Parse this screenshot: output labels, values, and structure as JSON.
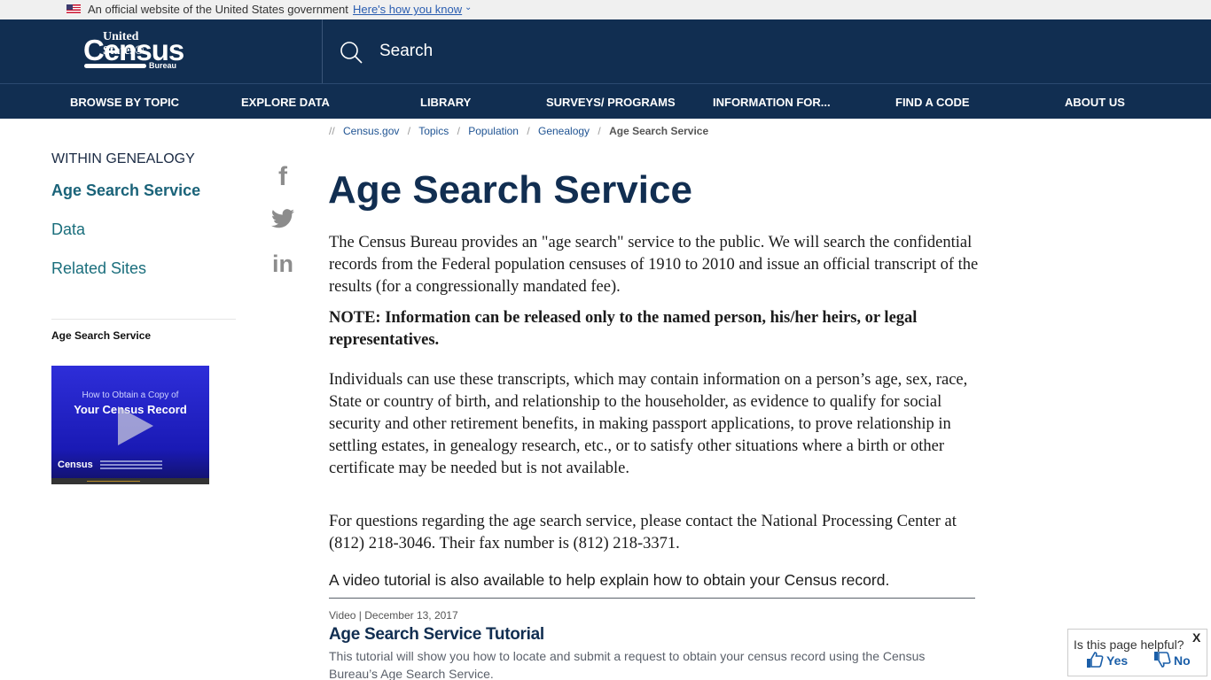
{
  "gov_banner": {
    "text": "An official website of the United States government",
    "link": "Here's how you know",
    "chevron": "⌄"
  },
  "header": {
    "logo": {
      "top": "United States®",
      "main": "Census",
      "bottom": "Bureau"
    },
    "search_label": "Search"
  },
  "nav": {
    "items": [
      {
        "label": "BROWSE BY TOPIC"
      },
      {
        "label": "EXPLORE DATA"
      },
      {
        "label": "LIBRARY"
      },
      {
        "label": "SURVEYS/ PROGRAMS"
      },
      {
        "label": "INFORMATION FOR..."
      },
      {
        "label": "FIND A CODE"
      },
      {
        "label": "ABOUT US"
      }
    ]
  },
  "breadcrumb": {
    "lead": "//",
    "sep": "/",
    "items": [
      "Census.gov",
      "Topics",
      "Population",
      "Genealogy"
    ],
    "current": "Age Search Service"
  },
  "sidebar": {
    "heading": "WITHIN GENEALOGY",
    "links": [
      {
        "label": "Age Search Service",
        "active": true
      },
      {
        "label": "Data"
      },
      {
        "label": "Related Sites"
      }
    ],
    "video_caption": "Age Search Service",
    "video_thumb": {
      "line1": "How to Obtain a Copy of",
      "line2": "Your Census Record",
      "logo": "Census"
    }
  },
  "social": {
    "facebook": "f",
    "linkedin": "in"
  },
  "main": {
    "title": "Age Search Service",
    "paragraphs": [
      "The Census Bureau provides an \"age search\" service to the public. We will search the confidential records from the Federal population censuses of 1910 to 2010 and issue an official transcript of the results (for a congressionally mandated fee).",
      "NOTE: Information can be released only to the named person, his/her heirs, or legal representatives.",
      "Individuals can use these transcripts, which may contain information on a person’s age, sex, race, State or country of birth, and relationship to the householder, as evidence to qualify for social security and other retirement benefits, in making passport applications, to prove relationship in settling estates, in genealogy research, etc., or to satisfy other situations where a birth or other certificate may be needed but is not available.",
      "For questions regarding the age search service, please contact the National Processing Center at (812) 218-3046. Their fax number is (812) 218-3371."
    ],
    "video_line": "A video tutorial is also available to help explain how to obtain your Census record.",
    "tutorial": {
      "meta": "Video | December 13, 2017",
      "title": "Age Search Service Tutorial",
      "description": "This tutorial will show you how to locate and submit a request to obtain your census record using the Census Bureau’s Age Search Service."
    }
  },
  "feedback": {
    "question": "Is this page helpful?",
    "close": "X",
    "yes": "Yes",
    "no": "No"
  },
  "colors": {
    "header_bg": "#112e51",
    "link_teal": "#1a6e7c",
    "feedback_blue": "#1a5ea8"
  }
}
